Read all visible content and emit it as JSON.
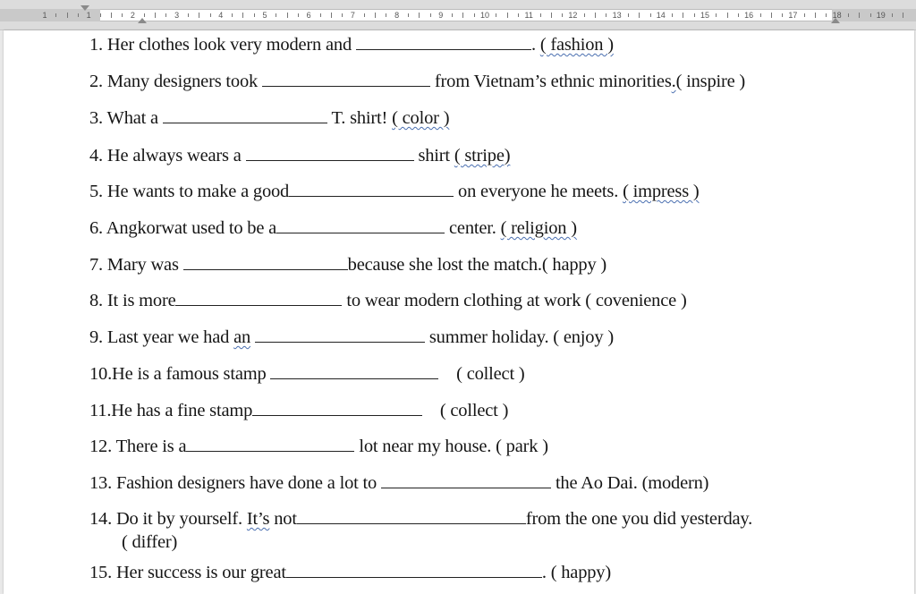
{
  "ruler": {
    "numbers": [
      "1",
      "1",
      "2",
      "3",
      "4",
      "5",
      "6",
      "7",
      "8",
      "9",
      "10",
      "11",
      "12",
      "13",
      "14",
      "15",
      "16",
      "17",
      "18",
      "19"
    ]
  },
  "questions": [
    {
      "num": "1.",
      "before": " Her clothes look very modern and ",
      "after": ". ",
      "hint": "( fashion )"
    },
    {
      "num": "2.",
      "before": " Many designers took ",
      "after": " from Vietnam’s ethnic minorities",
      "hint": "( inspire )"
    },
    {
      "num": "3.",
      "before": " What a ",
      "after": " T. shirt! ",
      "hint": "( color )"
    },
    {
      "num": "4.",
      "before": " He always wears a ",
      "after": " shirt ",
      "hint": "( stripe)"
    },
    {
      "num": "5.",
      "before": " He wants to make a good",
      "after": " on everyone he meets. ",
      "hint": "( impress )"
    },
    {
      "num": "6.",
      "before": " Angkorwat used to be a",
      "after": " center. ",
      "hint": "( religion )"
    },
    {
      "num": "7.",
      "before": " Mary was ",
      "after": "because she lost the match.",
      "hint": "( happy )"
    },
    {
      "num": "8.",
      "before": " It is more",
      "after": " to wear modern clothing at work ",
      "hint": "( covenience )"
    },
    {
      "num": "9.",
      "before": " Last year we had ",
      "article": "an",
      "after": " summer holiday. ",
      "hint": "( enjoy )"
    },
    {
      "num": "10.",
      "before": "He is a famous stamp ",
      "after": " ",
      "hint": "( collect )"
    },
    {
      "num": "11.",
      "before": "He has a fine stamp",
      "after": " ",
      "hint": "( collect )"
    },
    {
      "num": "12.",
      "before": " There is a",
      "after": " lot near my house. ",
      "hint": "( park )"
    },
    {
      "num": "13.",
      "before": " Fashion designers have done a lot to ",
      "after": " the Ao Dai. ",
      "hint": "(modern)"
    },
    {
      "num": "14.",
      "before": " Do it by yourself. ",
      "its": "It’s",
      "before2": " not",
      "after": "from the one you did yesterday.",
      "hint": "( differ)"
    },
    {
      "num": "15.",
      "before": " Her success is our great",
      "after": ". ",
      "hint": "( happy)"
    }
  ]
}
